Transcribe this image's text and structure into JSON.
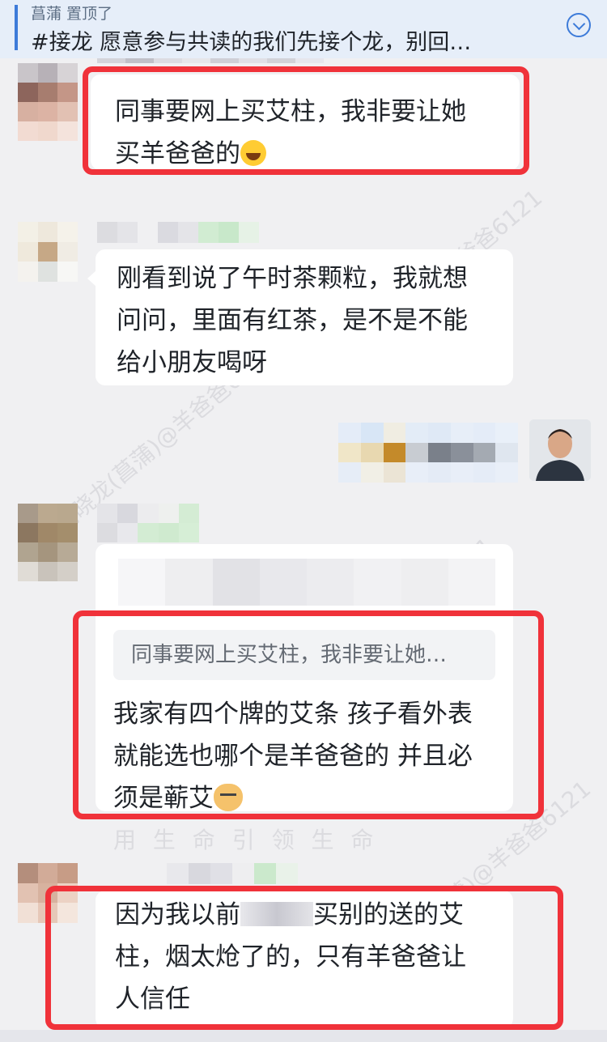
{
  "pinned": {
    "sender": "菖蒲 置顶了",
    "content": "#接龙 愿意参与共读的我们先接个龙，别回…"
  },
  "watermark_text": "刘晓龙(菖蒲)@羊爸爸6121",
  "watermark_footer": "用 生 命 引 领 生 命",
  "messages": [
    {
      "id": "m1",
      "text_line1": "同事要网上买艾柱，我非要让她",
      "text_line2": "买羊爸爸的",
      "emoji": "laugh-emoji"
    },
    {
      "id": "m2",
      "text_line1": "刚看到说了午时茶颗粒，我就想",
      "text_line2": "问问，里面有红茶，是不是不能",
      "text_line3": "给小朋友喝呀"
    },
    {
      "id": "m4",
      "quote": "同事要网上买艾柱，我非要让她…",
      "text_line1": "我家有四个牌的艾条 孩子看外表",
      "text_line2": "就能选也哪个是羊爸爸的 并且必",
      "text_line3": "须是蕲艾",
      "emoji": "dog-emoji"
    },
    {
      "id": "m5",
      "text_line1_a": "因为我以前",
      "text_line1_b": "买别的送的艾",
      "text_line2": "柱，烟太炝了的，只有羊爸爸让",
      "text_line3": "人信任"
    }
  ],
  "colors": {
    "highlight": "#f0323a",
    "accent": "#3d7bd9",
    "bubble": "#ffffff",
    "background": "#f0f0f2"
  }
}
